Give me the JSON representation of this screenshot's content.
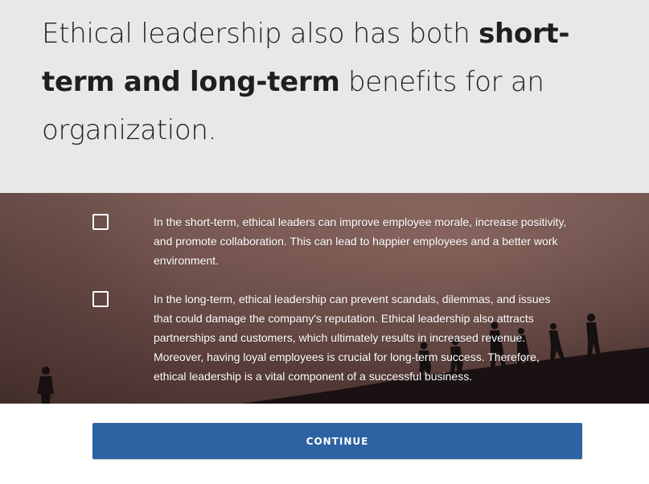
{
  "heading": {
    "prefix": "Ethical leadership also has both ",
    "bold": "short-term and long-term",
    "suffix": " benefits for an organization."
  },
  "items": [
    {
      "text": "In the short-term, ethical leaders can improve employee morale, increase positivity, and promote collaboration. This can lead to happier employees and a better work environment.",
      "checked": false
    },
    {
      "text": "In the long-term, ethical leadership can prevent scandals, dilemmas, and issues that could damage the company's reputation. Ethical leadership also attracts partnerships and customers, which ultimately results in increased revenue. Moreover, having loyal employees is crucial for long-term success. Therefore, ethical leadership is a vital component of a successful business.",
      "checked": false
    }
  ],
  "continue_label": "CONTINUE",
  "colors": {
    "heading_band": "#e8e8e8",
    "button": "#2d62a3",
    "photo_tone": "#6c4d48"
  }
}
